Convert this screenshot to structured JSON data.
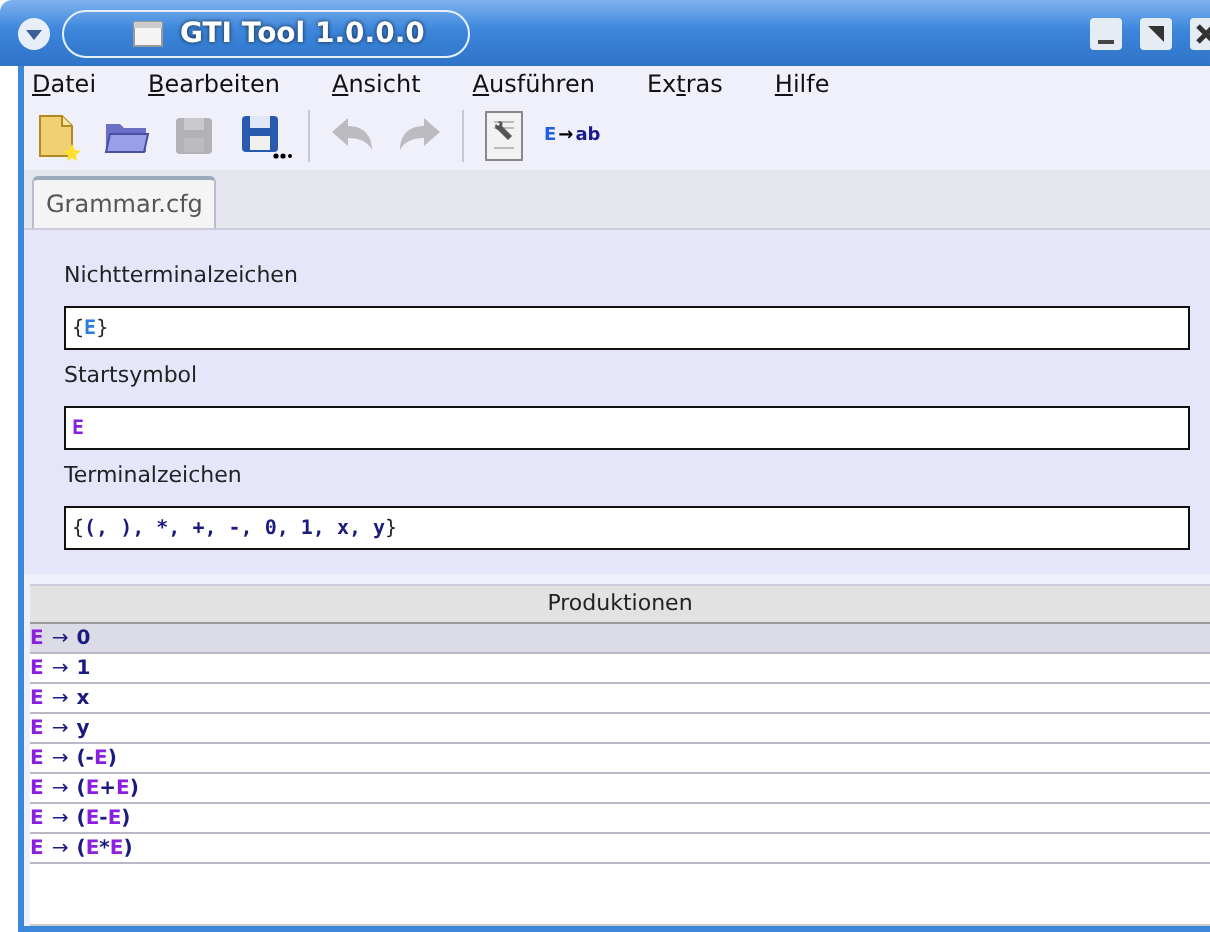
{
  "window": {
    "title": "GTI Tool 1.0.0.0"
  },
  "menu": [
    {
      "parts": [
        {
          "text": "D",
          "underlined": true
        },
        {
          "text": "atei",
          "underlined": false
        }
      ]
    },
    {
      "parts": [
        {
          "text": "B",
          "underlined": true
        },
        {
          "text": "earbeiten",
          "underlined": false
        }
      ]
    },
    {
      "parts": [
        {
          "text": "A",
          "underlined": true
        },
        {
          "text": "nsicht",
          "underlined": false
        }
      ]
    },
    {
      "parts": [
        {
          "text": "A",
          "underlined": true
        },
        {
          "text": "usführen",
          "underlined": false
        }
      ]
    },
    {
      "parts": [
        {
          "text": "Ex",
          "underlined": false
        },
        {
          "text": "t",
          "underlined": true
        },
        {
          "text": "ras",
          "underlined": false
        }
      ]
    },
    {
      "parts": [
        {
          "text": "H",
          "underlined": true
        },
        {
          "text": "ilfe",
          "underlined": false
        }
      ]
    }
  ],
  "toolbar": [
    {
      "kind": "new",
      "disabled": false
    },
    {
      "kind": "open",
      "disabled": false
    },
    {
      "kind": "save",
      "disabled": true
    },
    {
      "kind": "save-as",
      "disabled": false
    },
    {
      "kind": "separator"
    },
    {
      "kind": "undo",
      "disabled": true
    },
    {
      "kind": "redo",
      "disabled": true
    },
    {
      "kind": "separator"
    },
    {
      "kind": "properties",
      "disabled": false
    },
    {
      "kind": "convert",
      "left": "E",
      "arrow": "→",
      "right": "ab",
      "disabled": false
    }
  ],
  "tabs": [
    {
      "label": "Grammar.cfg",
      "selected": true
    }
  ],
  "fields": [
    {
      "label": "Nichtterminalzeichen",
      "value": [
        {
          "text": "{",
          "kind": "plain"
        },
        {
          "text": "E",
          "kind": "nonterminal-blue"
        },
        {
          "text": "}",
          "kind": "plain"
        }
      ]
    },
    {
      "label": "Startsymbol",
      "value": [
        {
          "text": "E",
          "kind": "nonterminal"
        }
      ]
    },
    {
      "label": "Terminalzeichen",
      "value": [
        {
          "text": "{",
          "kind": "plain"
        },
        {
          "text": "(, ), *, +, -, 0, 1, x, y",
          "kind": "terminal"
        },
        {
          "text": "}",
          "kind": "plain"
        }
      ]
    }
  ],
  "productions": {
    "header": "Produktionen",
    "rows": [
      {
        "left": "E",
        "arrow": "→",
        "right": [
          {
            "text": "0",
            "kind": "terminal"
          }
        ],
        "selected": true
      },
      {
        "left": "E",
        "arrow": "→",
        "right": [
          {
            "text": "1",
            "kind": "terminal"
          }
        ],
        "selected": false
      },
      {
        "left": "E",
        "arrow": "→",
        "right": [
          {
            "text": "x",
            "kind": "terminal"
          }
        ],
        "selected": false
      },
      {
        "left": "E",
        "arrow": "→",
        "right": [
          {
            "text": "y",
            "kind": "terminal"
          }
        ],
        "selected": false
      },
      {
        "left": "E",
        "arrow": "→",
        "right": [
          {
            "text": "(-",
            "kind": "terminal"
          },
          {
            "text": "E",
            "kind": "nonterminal"
          },
          {
            "text": ")",
            "kind": "terminal"
          }
        ],
        "selected": false
      },
      {
        "left": "E",
        "arrow": "→",
        "right": [
          {
            "text": "(",
            "kind": "terminal"
          },
          {
            "text": "E",
            "kind": "nonterminal"
          },
          {
            "text": "+",
            "kind": "terminal"
          },
          {
            "text": "E",
            "kind": "nonterminal"
          },
          {
            "text": ")",
            "kind": "terminal"
          }
        ],
        "selected": false
      },
      {
        "left": "E",
        "arrow": "→",
        "right": [
          {
            "text": "(",
            "kind": "terminal"
          },
          {
            "text": "E",
            "kind": "nonterminal"
          },
          {
            "text": "-",
            "kind": "terminal"
          },
          {
            "text": "E",
            "kind": "nonterminal"
          },
          {
            "text": ")",
            "kind": "terminal"
          }
        ],
        "selected": false
      },
      {
        "left": "E",
        "arrow": "→",
        "right": [
          {
            "text": "(",
            "kind": "terminal"
          },
          {
            "text": "E",
            "kind": "nonterminal"
          },
          {
            "text": "*",
            "kind": "terminal"
          },
          {
            "text": "E",
            "kind": "nonterminal"
          },
          {
            "text": ")",
            "kind": "terminal"
          }
        ],
        "selected": false
      }
    ]
  }
}
